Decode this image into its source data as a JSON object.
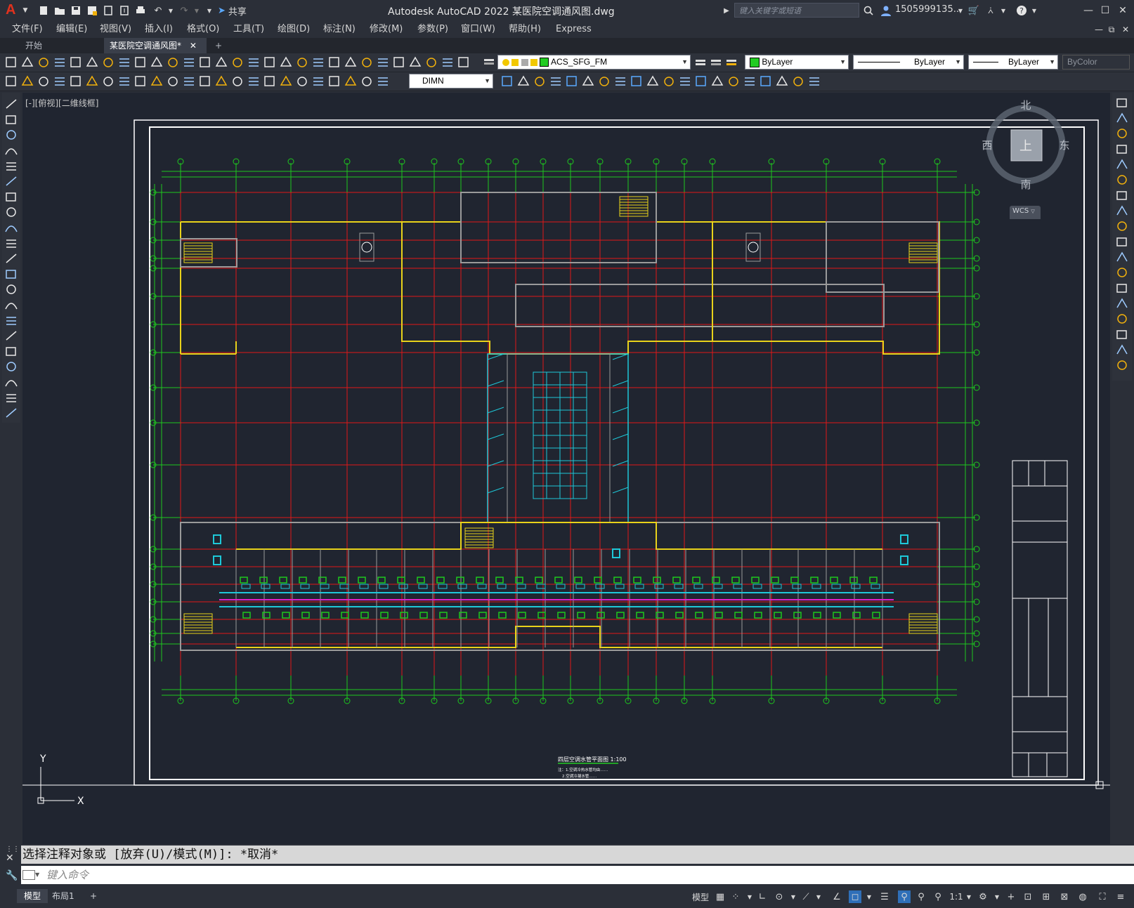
{
  "app": {
    "title": "Autodesk AutoCAD 2022    某医院空调通风图.dwg",
    "logo": "A",
    "share_label": "共享",
    "search_placeholder": "键入关键字或短语",
    "user_label": "1505999135...",
    "accent_color": "#e0321e"
  },
  "menu": [
    "文件(F)",
    "编辑(E)",
    "视图(V)",
    "插入(I)",
    "格式(O)",
    "工具(T)",
    "绘图(D)",
    "标注(N)",
    "修改(M)",
    "参数(P)",
    "窗口(W)",
    "帮助(H)",
    "Express"
  ],
  "tabs": {
    "start": "开始",
    "active": "某医院空调通风图*",
    "close": "✕",
    "add": "+"
  },
  "toolbar": {
    "layer": "ACS_SFG_FM",
    "color": "ByLayer",
    "linetype": "ByLayer",
    "lineweight": "ByLayer",
    "plotstyle": "ByColor",
    "dimstyle": "DIMN"
  },
  "viewport": {
    "label": "[-][俯视][二维线框]",
    "viewcube": {
      "north": "北",
      "south": "南",
      "east": "东",
      "west": "西",
      "face": "上",
      "wcs": "WCS"
    }
  },
  "drawing": {
    "plan_title": "四层空调水管平面图 1:100",
    "note1": "注：1.空调冷热水管均由……",
    "note2": "2.空调冷凝水管……",
    "ucs_x": "X",
    "ucs_y": "Y"
  },
  "command": {
    "history": "选择注释对象或 [放弃(U)/模式(M)]: *取消*",
    "placeholder": "键入命令"
  },
  "status": {
    "model_tab": "模型",
    "layout_tab": "布局1",
    "add": "+",
    "model_btn": "模型",
    "scale": "1:1"
  }
}
